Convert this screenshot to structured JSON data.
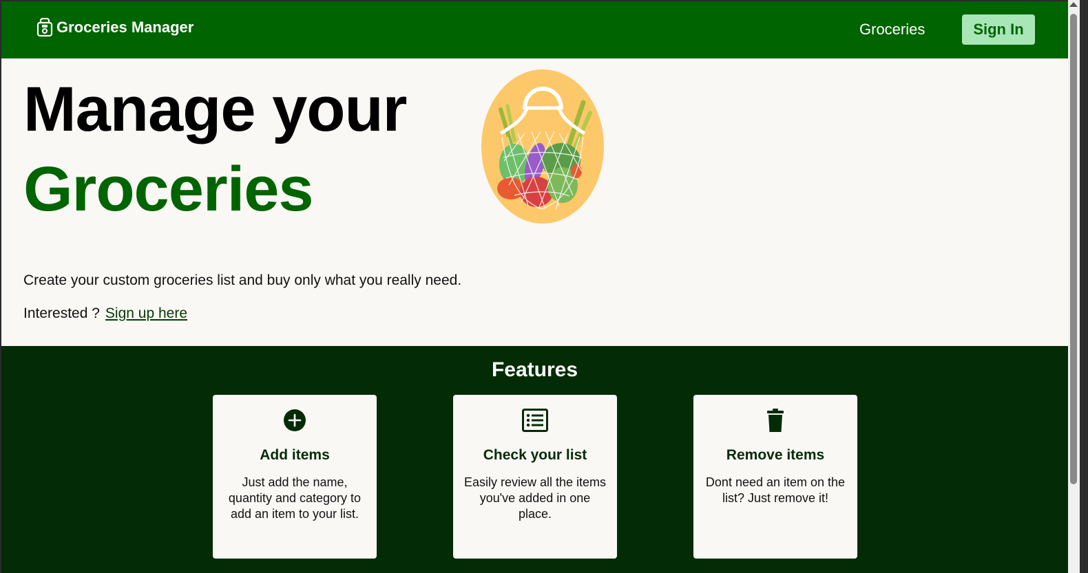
{
  "navbar": {
    "brand_name": "Groceries Manager",
    "brand_icon": "grocery-bag-icon",
    "nav_link_label": "Groceries",
    "signin_label": "Sign In"
  },
  "hero": {
    "headline_line1": "Manage your",
    "headline_line2": "Groceries",
    "illustration": "grocery-net-bag-illustration",
    "description": "Create your custom groceries list and buy only what you really need.",
    "cta_prefix": "Interested ?",
    "cta_link_label": "Sign up here"
  },
  "features": {
    "title": "Features",
    "cards": [
      {
        "icon": "plus-circle-icon",
        "title": "Add items",
        "text": "Just add the name, quantity and category to add an item to your list."
      },
      {
        "icon": "list-icon",
        "title": "Check your list",
        "text": "Easily review all the items you've added in one place."
      },
      {
        "icon": "trash-icon",
        "title": "Remove items",
        "text": "Dont need an item on the list? Just remove it!"
      }
    ]
  },
  "colors": {
    "primary_green": "#006400",
    "dark_green": "#032c06",
    "signin_bg": "#a8e6b8",
    "page_bg": "#faf8f5"
  }
}
